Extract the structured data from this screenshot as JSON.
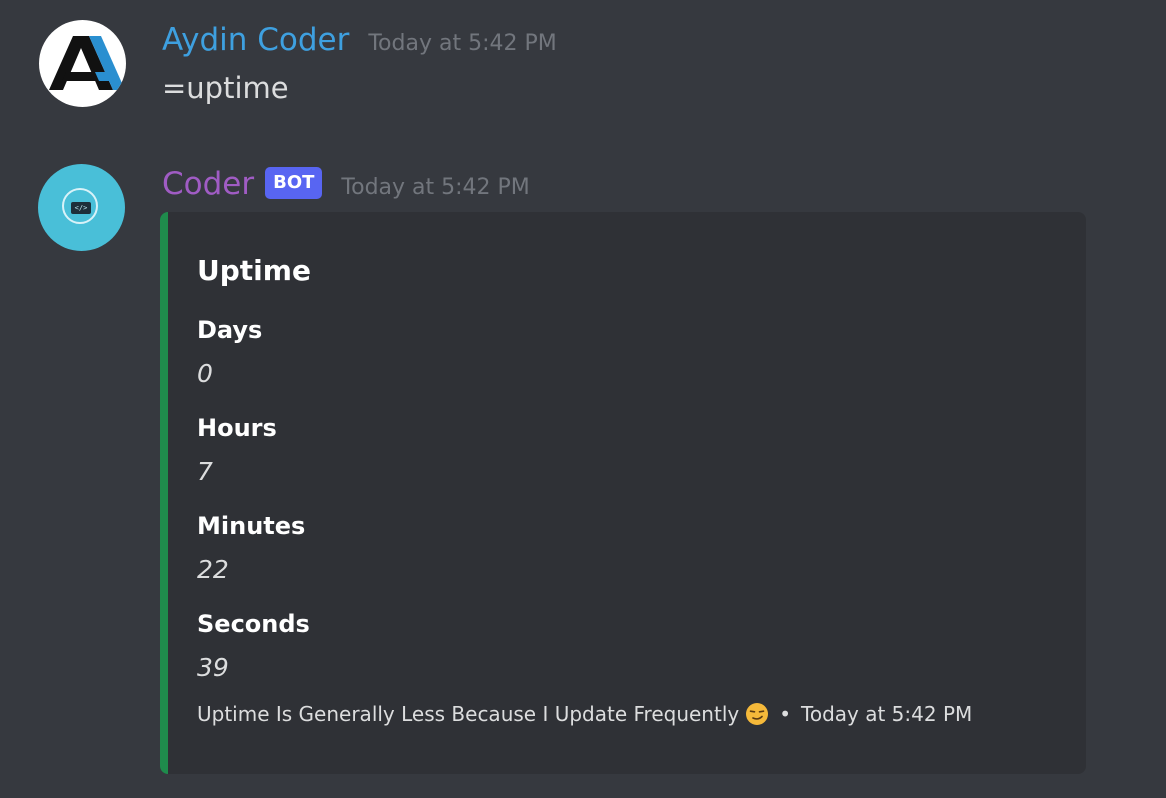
{
  "messages": {
    "user": {
      "username": "Aydin Coder",
      "timestamp": "Today at 5:42 PM",
      "content": "=uptime",
      "avatar_icon": "logo-a-icon",
      "name_color": "#3ea0e0"
    },
    "bot": {
      "username": "Coder",
      "badge": "BOT",
      "timestamp": "Today at 5:42 PM",
      "avatar_icon": "code-icon",
      "name_color": "#a05cc4",
      "embed": {
        "accent_color": "#1f8b4c",
        "title": "Uptime",
        "fields": [
          {
            "name": "Days",
            "value": "0"
          },
          {
            "name": "Hours",
            "value": "7"
          },
          {
            "name": "Minutes",
            "value": "22"
          },
          {
            "name": "Seconds",
            "value": "39"
          }
        ],
        "footer": {
          "text": "Uptime Is Generally Less Because I Update Frequently",
          "emoji": "smirk-emoji-icon",
          "separator": "•",
          "timestamp": "Today at 5:42 PM"
        }
      }
    }
  }
}
